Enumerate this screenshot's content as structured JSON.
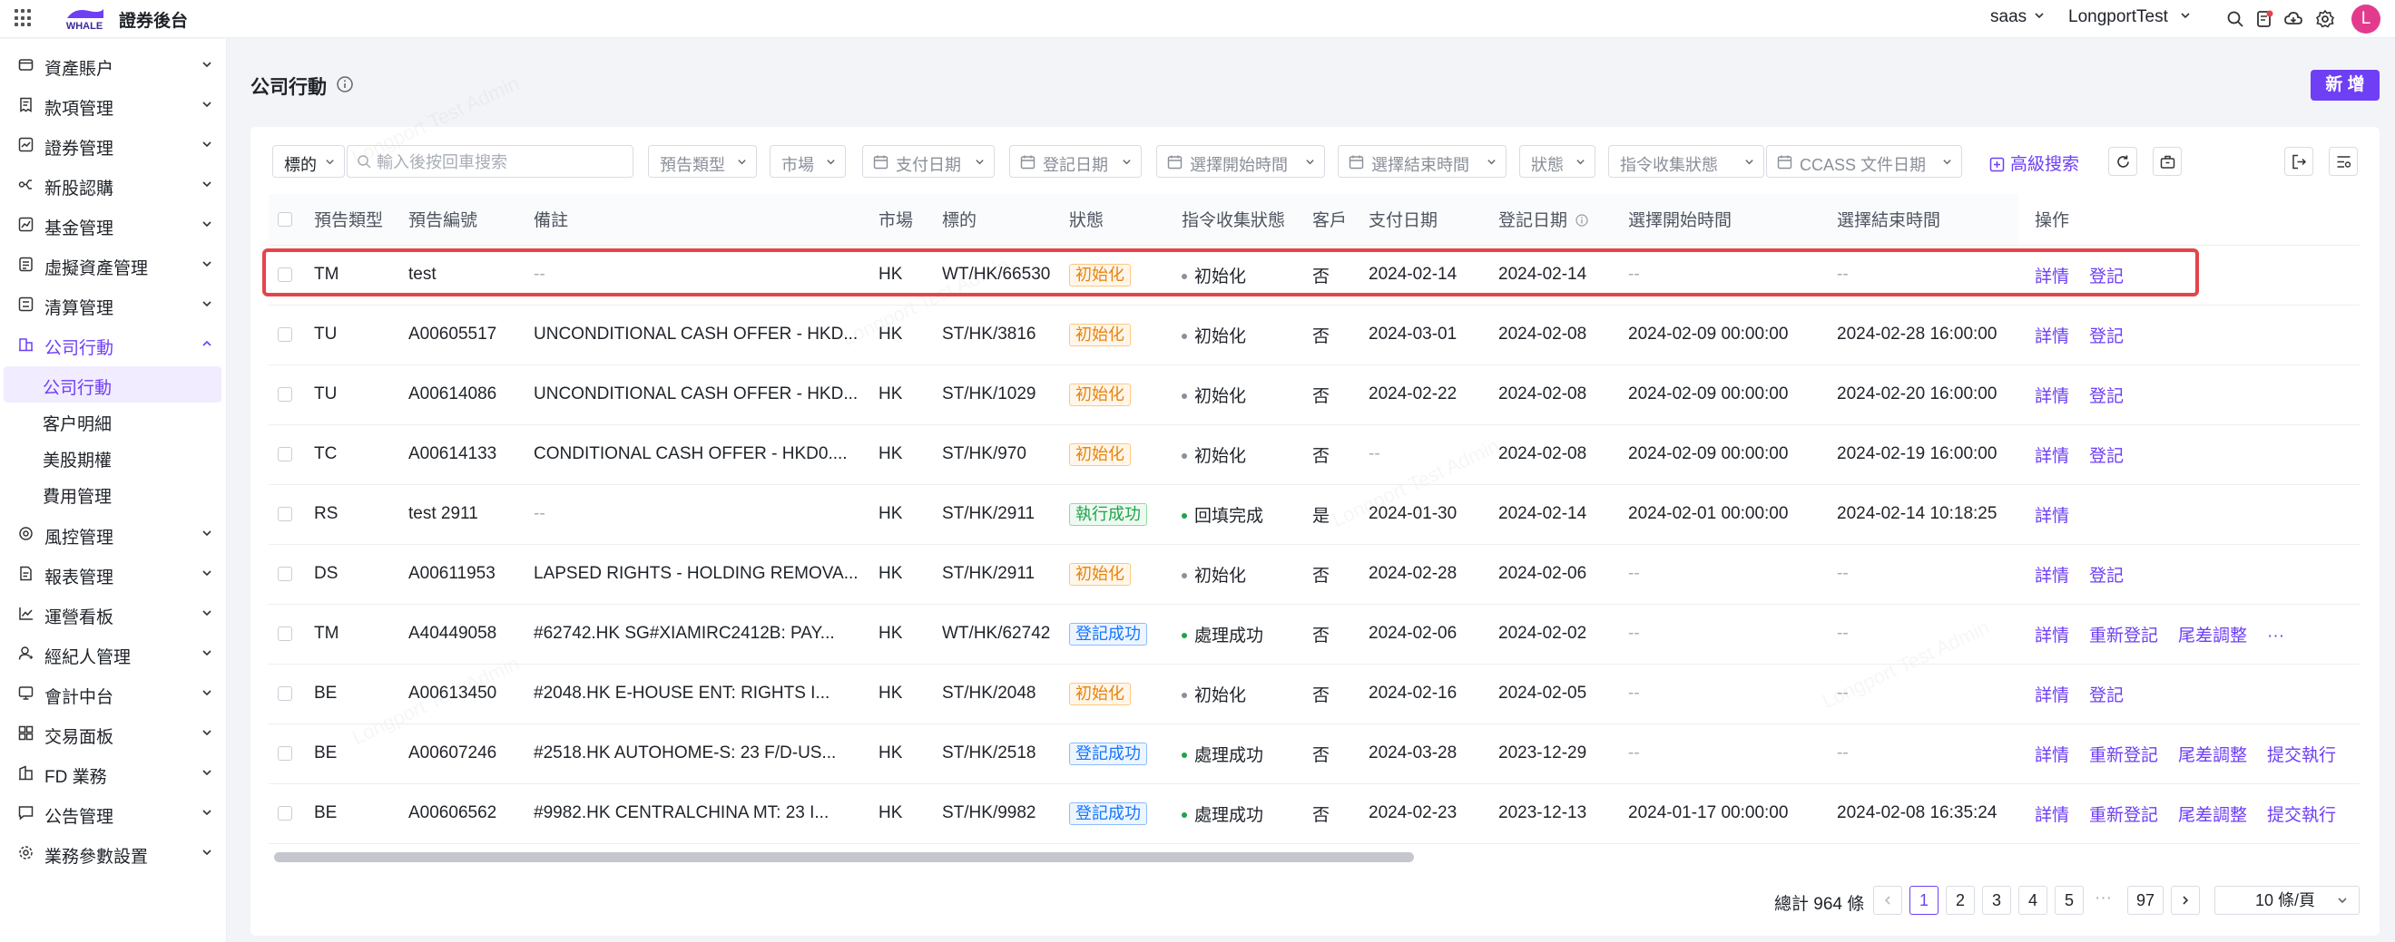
{
  "app": {
    "logo_text": "WHALE",
    "title": "證券後台"
  },
  "topbar": {
    "tenant": "saas",
    "account": "LongportTest",
    "avatar_letter": "L"
  },
  "sidebar": {
    "items": [
      {
        "label": "資產賬户",
        "icon": "wallet-icon"
      },
      {
        "label": "款項管理",
        "icon": "receipt-icon"
      },
      {
        "label": "證券管理",
        "icon": "chart-box-icon"
      },
      {
        "label": "新股認購",
        "icon": "split-icon"
      },
      {
        "label": "基金管理",
        "icon": "fund-icon"
      },
      {
        "label": "虛擬資產管理",
        "icon": "coin-icon"
      },
      {
        "label": "清算管理",
        "icon": "clear-icon"
      },
      {
        "label": "公司行動",
        "icon": "building-icon"
      },
      {
        "label": "風控管理",
        "icon": "shield-icon"
      },
      {
        "label": "報表管理",
        "icon": "report-icon"
      },
      {
        "label": "運營看板",
        "icon": "trend-icon"
      },
      {
        "label": "經紀人管理",
        "icon": "user-icon"
      },
      {
        "label": "會計中台",
        "icon": "monitor-icon"
      },
      {
        "label": "交易面板",
        "icon": "grid-icon"
      },
      {
        "label": "FD 業務",
        "icon": "bank-icon"
      },
      {
        "label": "公告管理",
        "icon": "message-icon"
      },
      {
        "label": "業務參數設置",
        "icon": "settings-icon"
      }
    ],
    "sub_items": [
      "公司行動",
      "客户明細",
      "美股期權",
      "費用管理"
    ]
  },
  "page": {
    "title": "公司行動",
    "new_button": "新 增"
  },
  "filters": {
    "search_type": "標的",
    "search_placeholder": "輸入後按回車搜索",
    "notice_type": "預告類型",
    "market": "市場",
    "pay_date": "支付日期",
    "record_date": "登記日期",
    "select_start": "選擇開始時間",
    "select_end": "選擇結束時間",
    "status": "狀態",
    "instruction_status": "指令收集狀態",
    "ccass_date": "CCASS 文件日期",
    "advanced": "高級搜索"
  },
  "table": {
    "headers": [
      "預告類型",
      "預告編號",
      "備註",
      "市場",
      "標的",
      "狀態",
      "指令收集狀態",
      "客戶",
      "支付日期",
      "登記日期",
      "選擇開始時間",
      "選擇結束時間",
      "操作"
    ],
    "rows": [
      {
        "type": "TM",
        "no": "test",
        "note": "--",
        "market": "HK",
        "symbol": "WT/HK/66530",
        "status": "初始化",
        "status_color": "orange",
        "instr": "初始化",
        "instr_color": "#8a8f99",
        "client": "否",
        "pay": "2024-02-14",
        "record": "2024-02-14",
        "start": "--",
        "end": "--",
        "ops": [
          "詳情",
          "登記"
        ]
      },
      {
        "type": "TU",
        "no": "A00605517",
        "note": "UNCONDITIONAL CASH OFFER - HKD...",
        "market": "HK",
        "symbol": "ST/HK/3816",
        "status": "初始化",
        "status_color": "orange",
        "instr": "初始化",
        "instr_color": "#8a8f99",
        "client": "否",
        "pay": "2024-03-01",
        "record": "2024-02-08",
        "start": "2024-02-09 00:00:00",
        "end": "2024-02-28 16:00:00",
        "ops": [
          "詳情",
          "登記"
        ]
      },
      {
        "type": "TU",
        "no": "A00614086",
        "note": "UNCONDITIONAL CASH OFFER - HKD...",
        "market": "HK",
        "symbol": "ST/HK/1029",
        "status": "初始化",
        "status_color": "orange",
        "instr": "初始化",
        "instr_color": "#8a8f99",
        "client": "否",
        "pay": "2024-02-22",
        "record": "2024-02-08",
        "start": "2024-02-09 00:00:00",
        "end": "2024-02-20 16:00:00",
        "ops": [
          "詳情",
          "登記"
        ]
      },
      {
        "type": "TC",
        "no": "A00614133",
        "note": "CONDITIONAL CASH OFFER - HKD0....",
        "market": "HK",
        "symbol": "ST/HK/970",
        "status": "初始化",
        "status_color": "orange",
        "instr": "初始化",
        "instr_color": "#8a8f99",
        "client": "否",
        "pay": "--",
        "record": "2024-02-08",
        "start": "2024-02-09 00:00:00",
        "end": "2024-02-19 16:00:00",
        "ops": [
          "詳情",
          "登記"
        ]
      },
      {
        "type": "RS",
        "no": "test 2911",
        "note": "--",
        "market": "HK",
        "symbol": "ST/HK/2911",
        "status": "執行成功",
        "status_color": "green",
        "instr": "回填完成",
        "instr_color": "#1fa34a",
        "client": "是",
        "pay": "2024-01-30",
        "record": "2024-02-14",
        "start": "2024-02-01 00:00:00",
        "end": "2024-02-14 10:18:25",
        "ops": [
          "詳情"
        ]
      },
      {
        "type": "DS",
        "no": "A00611953",
        "note": "LAPSED RIGHTS - HOLDING REMOVA...",
        "market": "HK",
        "symbol": "ST/HK/2911",
        "status": "初始化",
        "status_color": "orange",
        "instr": "初始化",
        "instr_color": "#8a8f99",
        "client": "否",
        "pay": "2024-02-28",
        "record": "2024-02-06",
        "start": "--",
        "end": "--",
        "ops": [
          "詳情",
          "登記"
        ]
      },
      {
        "type": "TM",
        "no": "A40449058",
        "note": "#62742.HK SG#XIAMIRC2412B: PAY...",
        "market": "HK",
        "symbol": "WT/HK/62742",
        "status": "登記成功",
        "status_color": "blue",
        "instr": "處理成功",
        "instr_color": "#1fa34a",
        "client": "否",
        "pay": "2024-02-06",
        "record": "2024-02-02",
        "start": "--",
        "end": "--",
        "ops": [
          "詳情",
          "重新登記",
          "尾差調整",
          "···"
        ]
      },
      {
        "type": "BE",
        "no": "A00613450",
        "note": "#2048.HK E-HOUSE ENT: RIGHTS I...",
        "market": "HK",
        "symbol": "ST/HK/2048",
        "status": "初始化",
        "status_color": "orange",
        "instr": "初始化",
        "instr_color": "#8a8f99",
        "client": "否",
        "pay": "2024-02-16",
        "record": "2024-02-05",
        "start": "--",
        "end": "--",
        "ops": [
          "詳情",
          "登記"
        ]
      },
      {
        "type": "BE",
        "no": "A00607246",
        "note": "#2518.HK AUTOHOME-S: 23 F/D-US...",
        "market": "HK",
        "symbol": "ST/HK/2518",
        "status": "登記成功",
        "status_color": "blue",
        "instr": "處理成功",
        "instr_color": "#1fa34a",
        "client": "否",
        "pay": "2024-03-28",
        "record": "2023-12-29",
        "start": "--",
        "end": "--",
        "ops": [
          "詳情",
          "重新登記",
          "尾差調整",
          "提交執行"
        ]
      },
      {
        "type": "BE",
        "no": "A00606562",
        "note": "#9982.HK CENTRALCHINA MT: 23 I...",
        "market": "HK",
        "symbol": "ST/HK/9982",
        "status": "登記成功",
        "status_color": "blue",
        "instr": "處理成功",
        "instr_color": "#1fa34a",
        "client": "否",
        "pay": "2024-02-23",
        "record": "2023-12-13",
        "start": "2024-01-17 00:00:00",
        "end": "2024-02-08 16:35:24",
        "ops": [
          "詳情",
          "重新登記",
          "尾差調整",
          "提交執行"
        ]
      }
    ]
  },
  "pagination": {
    "total": "總計 964 條",
    "pages": [
      "1",
      "2",
      "3",
      "4",
      "5"
    ],
    "ellipsis": "···",
    "last": "97",
    "page_size": "10 條/頁"
  },
  "watermark": "Longport Test Admin",
  "colors": {
    "accent": "#6e3ff5",
    "highlight": "#e4454a"
  }
}
